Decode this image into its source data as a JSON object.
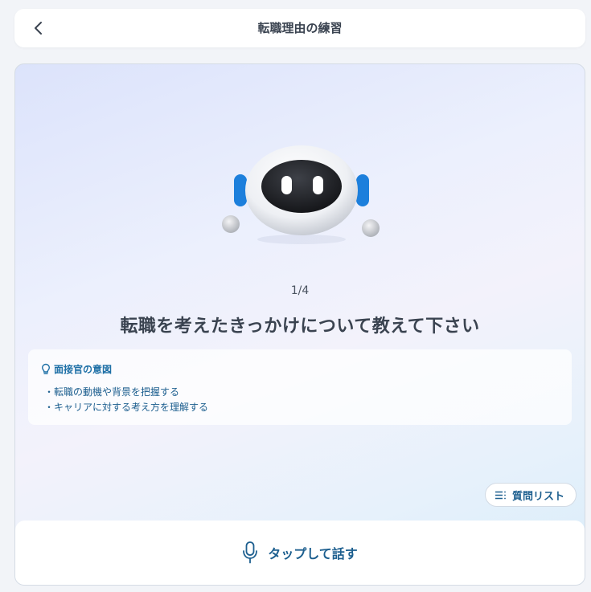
{
  "header": {
    "title": "転職理由の練習",
    "back_icon": "chevron-left-icon"
  },
  "main": {
    "progress": "1/4",
    "question": "転職を考えたきっかけについて教えて下さい",
    "intent": {
      "title": "面接官の意図",
      "icon": "lightbulb-icon",
      "items": [
        "・転職の動機や背景を把握する",
        "・キャリアに対する考え方を理解する"
      ]
    },
    "question_list_button": {
      "label": "質問リスト",
      "icon": "list-icon"
    }
  },
  "footer": {
    "mic_label": "タップして話す",
    "mic_icon": "microphone-icon"
  },
  "colors": {
    "accent": "#1d5f8f",
    "title_text": "#3a4350",
    "robot_ear": "#1c7fdc"
  }
}
